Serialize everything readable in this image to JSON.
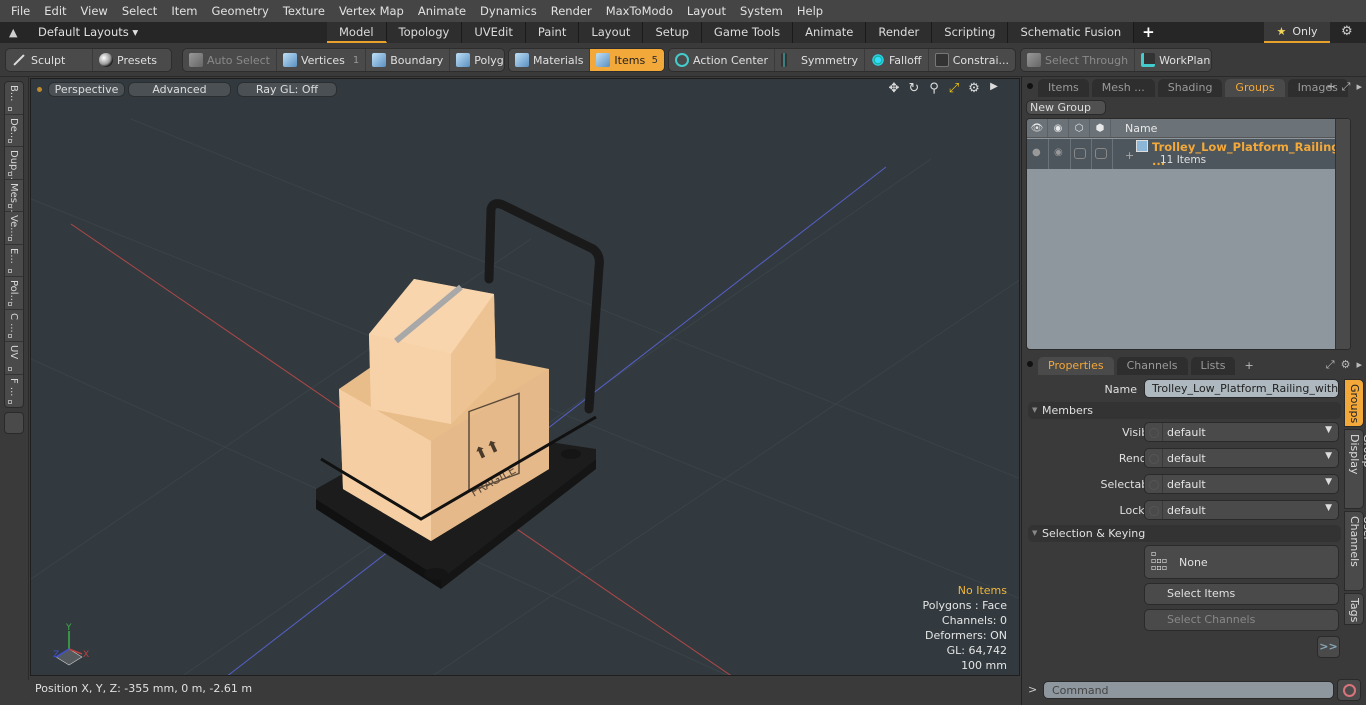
{
  "menu": [
    "File",
    "Edit",
    "View",
    "Select",
    "Item",
    "Geometry",
    "Texture",
    "Vertex Map",
    "Animate",
    "Dynamics",
    "Render",
    "MaxToModo",
    "Layout",
    "System",
    "Help"
  ],
  "layout_bar": {
    "layouts_label": "Default Layouts ▾",
    "tabs": [
      "Model",
      "Topology",
      "UVEdit",
      "Paint",
      "Layout",
      "Setup",
      "Game Tools",
      "Animate",
      "Render",
      "Scripting",
      "Schematic Fusion"
    ],
    "active_tab": "Model",
    "add_tab_label": "+",
    "only_label": "Only",
    "star_icon": "★",
    "gear_icon": "⚙"
  },
  "toolbar": {
    "sculpt": "Sculpt",
    "presets": "Presets",
    "auto_select": "Auto Select",
    "vertices": "Vertices",
    "vertices_count": "1",
    "boundary": "Boundary",
    "polygons": "Polygons",
    "materials": "Materials",
    "items": "Items",
    "items_count": "5",
    "action_center": "Action Center",
    "symmetry": "Symmetry",
    "falloff": "Falloff",
    "constraints": "Constrai...",
    "select_through": "Select Through",
    "workplane": "WorkPlane",
    "accent_color": "#f3a83a"
  },
  "left_tabs": [
    "B...",
    "De...",
    "Dup...",
    "Mes...",
    "Ve...",
    "E...",
    "Pol...",
    "C ...",
    "UV",
    "F ..."
  ],
  "viewport": {
    "view_mode": "Perspective",
    "shading": "Advanced",
    "raygl": "Ray GL: Off",
    "stats": {
      "selection": "No Items",
      "polygons": "Polygons : Face",
      "channels": "Channels: 0",
      "deformers": "Deformers: ON",
      "gl": "GL: 64,742",
      "grid": "100 mm"
    },
    "scene_labels": {
      "fragile": "FRAGILE"
    },
    "axis_labels": {
      "x": "X",
      "y": "Y",
      "z": "Z"
    }
  },
  "status_bar": {
    "position": "Position X, Y, Z:   -355 mm, 0 m, -2.61 m"
  },
  "groups_panel": {
    "tabs": [
      "Items",
      "Mesh ...",
      "Shading",
      "Groups",
      "Images"
    ],
    "active_tab": "Groups",
    "new_group_label": "New Group",
    "column_name": "Name",
    "groups": [
      {
        "name": "Trolley_Low_Platform_Railing_ ...",
        "sub": "11 Items"
      }
    ]
  },
  "properties_panel": {
    "tabs": [
      "Properties",
      "Channels",
      "Lists"
    ],
    "active_tab": "Properties",
    "name_label": "Name",
    "name_value": "Trolley_Low_Platform_Railing_with_Ca",
    "members_section": "Members",
    "fields": [
      {
        "label": "Visible",
        "value": "default"
      },
      {
        "label": "Render",
        "value": "default"
      },
      {
        "label": "Selectable",
        "value": "default"
      },
      {
        "label": "Locked",
        "value": "default"
      }
    ],
    "selection_section": "Selection & Keying",
    "keying_value": "None",
    "select_items": "Select Items",
    "select_channels": "Select Channels",
    "more_button": ">>",
    "side_tabs": [
      "Groups",
      "Group Display",
      "User Channels",
      "Tags"
    ],
    "active_side_tab": "Groups"
  },
  "command_bar": {
    "prompt": ">",
    "placeholder": "Command"
  }
}
